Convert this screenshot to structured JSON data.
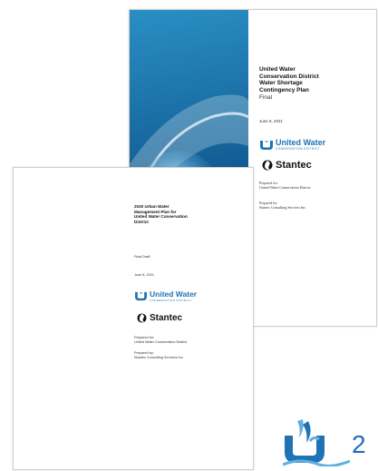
{
  "back_cover": {
    "title_lines": [
      "United Water",
      "Conservation District",
      "Water Shortage",
      "Contingency Plan"
    ],
    "subtitle": "Final",
    "date": "June 8, 2021",
    "logo": {
      "name": "United Water",
      "tagline": "CONSERVATION DISTRICT"
    },
    "consultant_logo": "Stantec",
    "prepared_for_label": "Prepared for:",
    "prepared_for": "United Water Conservation District",
    "prepared_by_label": "Prepared by:",
    "prepared_by": "Stantec Consulting Services Inc."
  },
  "front_cover": {
    "title_lines": [
      "2020 Urban Water",
      "Management Plan for",
      "United Water Conservation",
      "District"
    ],
    "subtitle": "Final Draft",
    "date": "June 8, 2021",
    "logo": {
      "name": "United Water",
      "tagline": "CONSERVATION DISTRICT"
    },
    "consultant_logo": "Stantec",
    "prepared_for_label": "Prepared for:",
    "prepared_for": "United Water Conservation District",
    "prepared_by_label": "Prepared by:",
    "prepared_by": "Stantec Consulting Services Inc."
  },
  "page_number": "2",
  "colors": {
    "brand_blue": "#1f73b5",
    "light_blue": "#5fb0e0"
  },
  "icons": {
    "brand": "water-drop-logo-icon",
    "stantec": "stantec-swirl-icon"
  }
}
